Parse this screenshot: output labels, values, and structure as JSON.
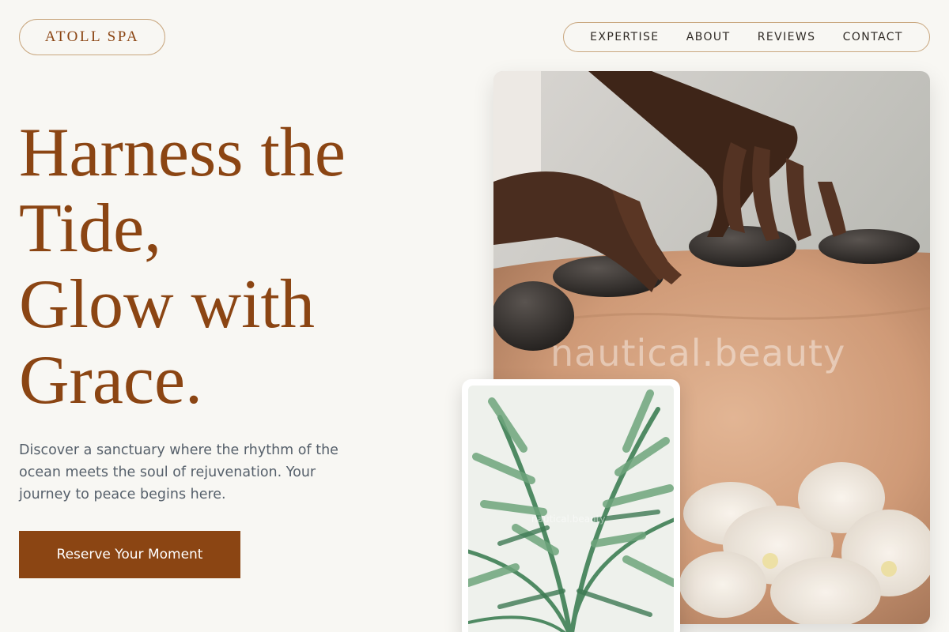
{
  "brand": {
    "name": "ATOLL SPA"
  },
  "nav": {
    "items": [
      {
        "label": "EXPERTISE"
      },
      {
        "label": "ABOUT"
      },
      {
        "label": "REVIEWS"
      },
      {
        "label": "CONTACT"
      }
    ]
  },
  "hero": {
    "headline_lines": [
      "Harness the",
      "Tide,",
      "Glow with",
      "Grace."
    ],
    "intro": "Discover a sanctuary where the rhythm of the ocean meets the soul of rejuvenation. Your journey to peace begins here.",
    "cta_label": "Reserve Your Moment"
  },
  "images": {
    "main_watermark": "nautical.beauty",
    "secondary_watermark": "nautical.beauty"
  },
  "colors": {
    "accent": "#8b4513",
    "background": "#f8f7f3",
    "border": "#c9a77f"
  }
}
